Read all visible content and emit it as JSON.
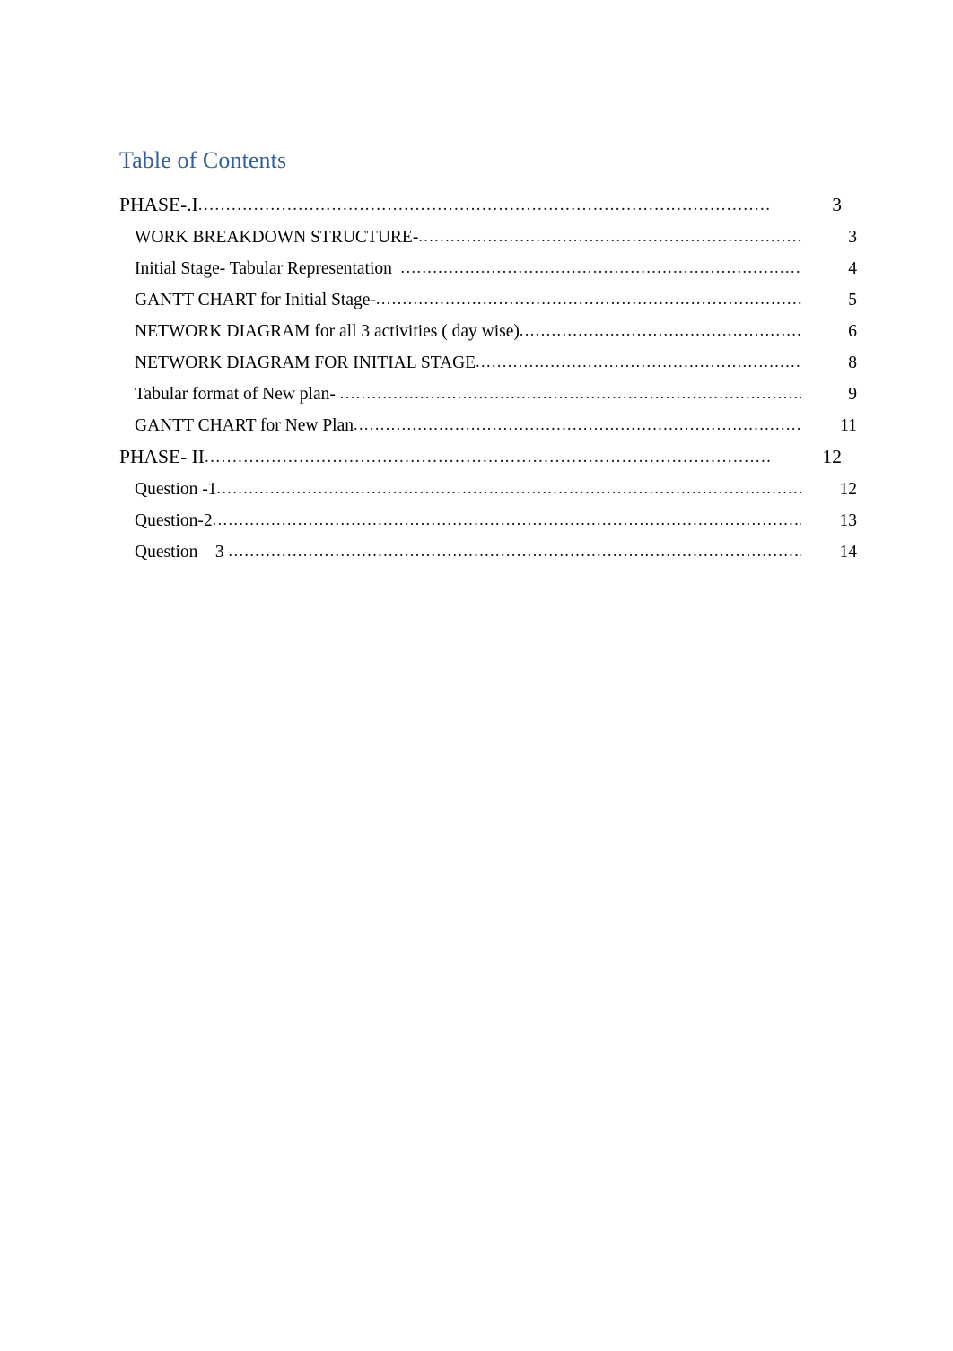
{
  "document": {
    "heading": "Table of Contents",
    "heading_color": "#365F91",
    "background_color": "#FFFFFF",
    "text_color": "#000000",
    "leader_character": "."
  },
  "toc": {
    "entries": [
      {
        "label": "PHASE-.I",
        "page": "3",
        "level": 1
      },
      {
        "label": "WORK BREAKDOWN STRUCTURE-",
        "page": "3",
        "level": 2
      },
      {
        "label": "Initial Stage- Tabular Representation  ",
        "page": "4",
        "level": 2
      },
      {
        "label": "GANTT CHART for Initial Stage-",
        "page": "5",
        "level": 2
      },
      {
        "label": "NETWORK DIAGRAM for all 3 activities ( day wise)",
        "page": "6",
        "level": 2
      },
      {
        "label": "NETWORK DIAGRAM FOR INITIAL STAGE",
        "page": "8",
        "level": 2
      },
      {
        "label": "Tabular format of New plan- ",
        "page": "9",
        "level": 2
      },
      {
        "label": "GANTT CHART for New Plan",
        "page": "11",
        "level": 2
      },
      {
        "label": "PHASE- II",
        "page": "12",
        "level": 1
      },
      {
        "label": "Question -1",
        "page": "12",
        "level": 2
      },
      {
        "label": "Question-2",
        "page": "13",
        "level": 2
      },
      {
        "label": "Question – 3 ",
        "page": "14",
        "level": 2
      }
    ]
  }
}
